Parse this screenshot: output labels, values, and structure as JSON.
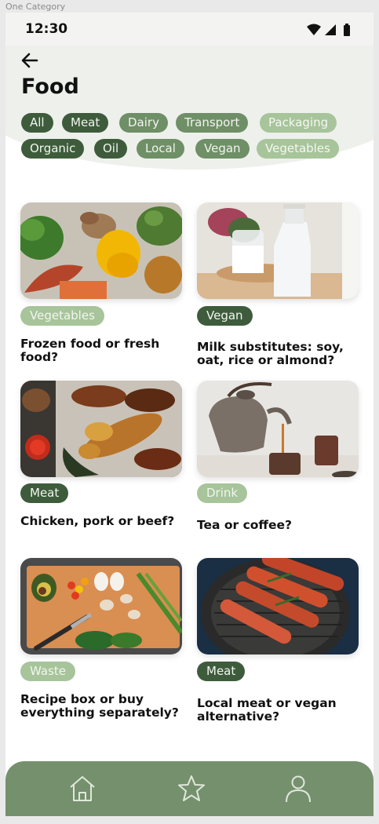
{
  "frame_label": "One Category",
  "status_bar": {
    "time": "12:30"
  },
  "header": {
    "title": "Food"
  },
  "filters": [
    {
      "label": "All",
      "style": "dark"
    },
    {
      "label": "Meat",
      "style": "dark"
    },
    {
      "label": "Dairy",
      "style": "medium"
    },
    {
      "label": "Transport",
      "style": "medium"
    },
    {
      "label": "Packaging",
      "style": "light"
    },
    {
      "label": "Organic",
      "style": "dark"
    },
    {
      "label": "Oil",
      "style": "dark"
    },
    {
      "label": "Local",
      "style": "medium"
    },
    {
      "label": "Vegan",
      "style": "medium"
    },
    {
      "label": "Vegetables",
      "style": "light"
    }
  ],
  "cards": [
    {
      "image": "vegetables-photo",
      "tag": "Vegetables",
      "tag_style": "light",
      "title": "Frozen food or fresh food?"
    },
    {
      "image": "milk-bottles-photo",
      "tag": "Vegan",
      "tag_style": "dark",
      "title": "Milk substitutes: soy, oat, rice or almond?"
    },
    {
      "image": "grilled-meat-photo",
      "tag": "Meat",
      "tag_style": "dark",
      "title": "Chicken, pork or beef?"
    },
    {
      "image": "teapot-pouring-photo",
      "tag": "Drink",
      "tag_style": "light",
      "title": "Tea or coffee?"
    },
    {
      "image": "cutting-board-ingredients-photo",
      "tag": "Waste",
      "tag_style": "light",
      "title": "Recipe box or buy everything separately?"
    },
    {
      "image": "sausages-grill-photo",
      "tag": "Meat",
      "tag_style": "dark",
      "title": "Local meat or vegan alternative?"
    }
  ],
  "bottom_nav": {
    "items": [
      {
        "icon": "home-icon"
      },
      {
        "icon": "star-icon"
      },
      {
        "icon": "profile-icon"
      }
    ]
  },
  "colors": {
    "dark_green": "#3e5c3c",
    "medium_green": "#6f8f66",
    "light_green": "#a7c49a",
    "nav_green": "#75906d"
  }
}
